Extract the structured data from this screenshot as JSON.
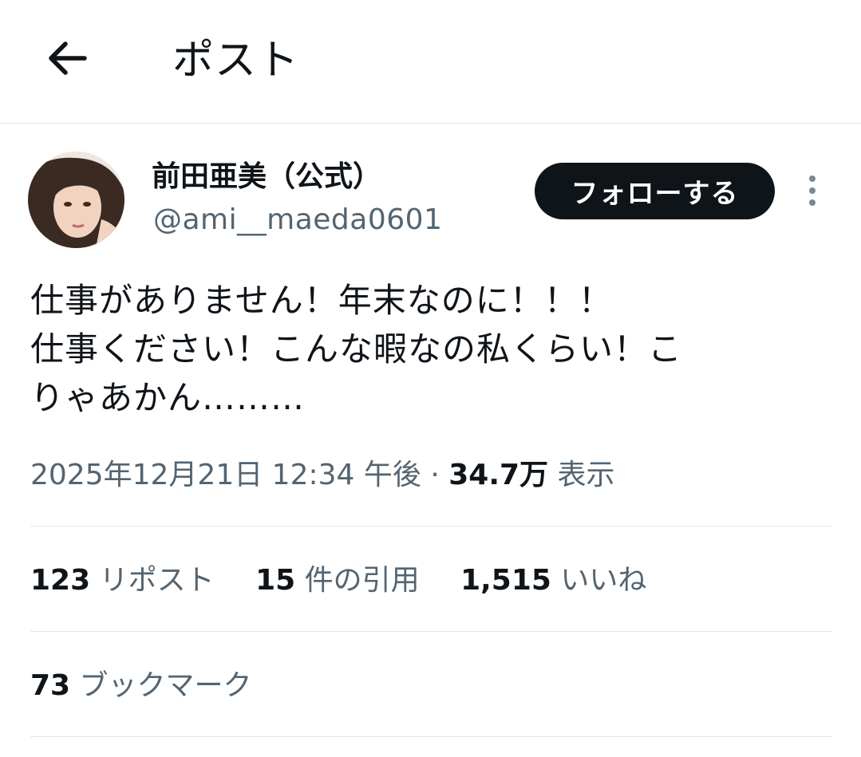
{
  "header": {
    "title": "ポスト",
    "back_icon": "arrow-left-icon"
  },
  "author": {
    "display_name": "前田亜美（公式）",
    "handle": "@ami__maeda0601",
    "follow_label": "フォローする",
    "more_icon": "more-vertical-icon"
  },
  "post": {
    "lines": [
      "仕事がありません！年末なのに！！！",
      "仕事ください！こんな暇なの私くらい！こ",
      "りゃあかん………"
    ],
    "datetime": "2025年12月21日 12:34 午後",
    "separator": " · ",
    "views_count": "34.7万",
    "views_label": " 表示"
  },
  "stats": {
    "reposts_count": "123",
    "reposts_label": " リポスト",
    "quotes_count": "15",
    "quotes_label": " 件の引用",
    "likes_count": "1,515",
    "likes_label": " いいね",
    "bookmarks_count": "73",
    "bookmarks_label": " ブックマーク"
  },
  "colors": {
    "text_primary": "#0f1419",
    "text_secondary": "#536471",
    "divider": "#e1e6ea",
    "button_bg": "#0f1419"
  }
}
